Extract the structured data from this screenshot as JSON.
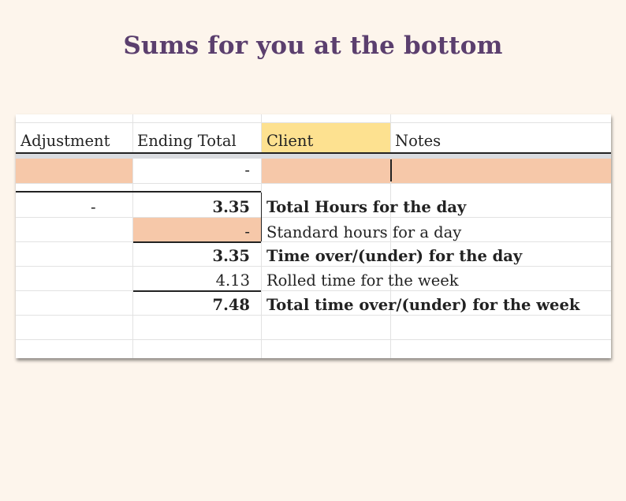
{
  "title": "Sums for you at the bottom",
  "headers": {
    "adjustment": "Adjustment",
    "ending_total": "Ending Total",
    "client": "Client",
    "notes": "Notes"
  },
  "entry_row": {
    "ending_total": "-"
  },
  "summary": {
    "adjustment": "-",
    "rows": [
      {
        "value": "3.35",
        "label": "Total Hours for the day"
      },
      {
        "value": "-",
        "label": "Standard hours for a day"
      },
      {
        "value": "3.35",
        "label": "Time over/(under) for the day"
      },
      {
        "value": "4.13",
        "label": "Rolled time for the week"
      },
      {
        "value": "7.48",
        "label": "Total time over/(under) for the week"
      }
    ]
  },
  "colors": {
    "title": "#5b3f6e",
    "background": "#fdf5ec",
    "input_fill": "#f6c8a9",
    "client_header_fill": "#fde190"
  }
}
